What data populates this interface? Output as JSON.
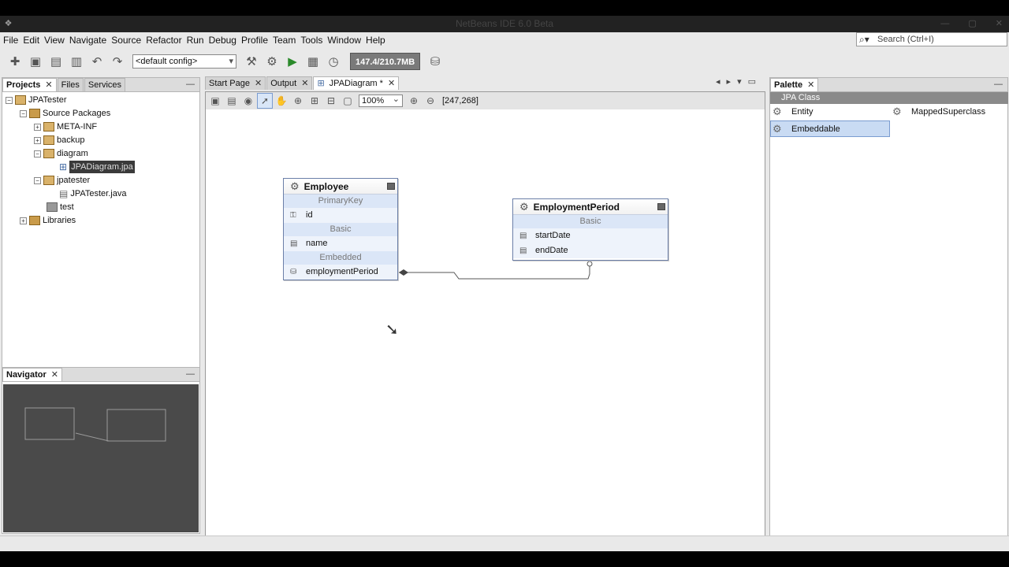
{
  "window": {
    "title": "NetBeans IDE 6.0 Beta"
  },
  "menu": [
    "File",
    "Edit",
    "View",
    "Navigate",
    "Source",
    "Refactor",
    "Run",
    "Debug",
    "Profile",
    "Team",
    "Tools",
    "Window",
    "Help"
  ],
  "search": {
    "placeholder": "Search (Ctrl+I)"
  },
  "toolbar": {
    "config": "<default config>",
    "memory": "147.4/210.7MB"
  },
  "projects_panel": {
    "tabs": [
      "Projects",
      "Files",
      "Services"
    ],
    "tree": {
      "root": "JPATester",
      "source_packages": "Source Packages",
      "meta_inf": "META-INF",
      "backup": "backup",
      "diagram": "diagram",
      "diagram_file": "JPADiagram.jpa",
      "jpatester": "jpatester",
      "jpatester_java": "JPATester.java",
      "test": "test",
      "libraries": "Libraries"
    }
  },
  "navigator": {
    "tab": "Navigator"
  },
  "editor": {
    "tabs": [
      "Start Page",
      "Output",
      "JPADiagram *"
    ],
    "zoom": "100%",
    "coords": "[247,268]"
  },
  "diagram": {
    "employee": {
      "name": "Employee",
      "sections": [
        "PrimaryKey",
        "Basic",
        "Embedded"
      ],
      "id": "id",
      "name_attr": "name",
      "embedded_attr": "employmentPeriod"
    },
    "employment_period": {
      "name": "EmploymentPeriod",
      "section": "Basic",
      "attrs": [
        "startDate",
        "endDate"
      ]
    }
  },
  "palette": {
    "tab": "Palette",
    "section": "JPA Class",
    "items": [
      "Entity",
      "MappedSuperclass",
      "Embeddable"
    ]
  }
}
